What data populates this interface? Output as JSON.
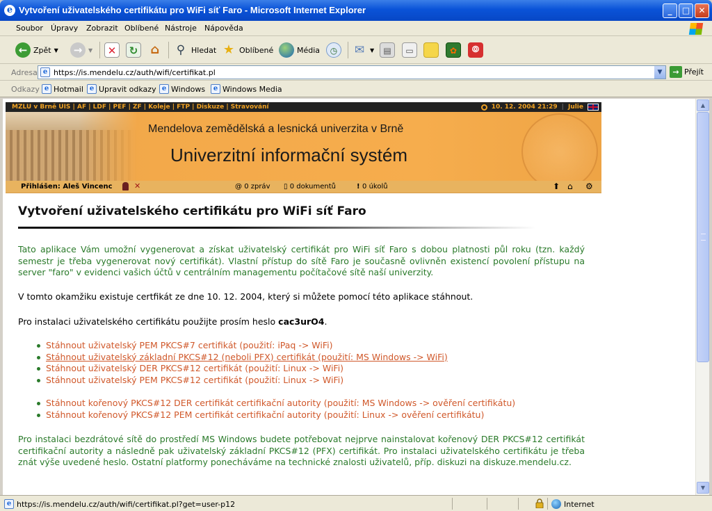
{
  "window": {
    "title": "Vytvoření uživatelského certifikátu pro WiFi síť Faro - Microsoft Internet Explorer",
    "minimize": "_",
    "maximize": "□",
    "close": "✕"
  },
  "menu": [
    "Soubor",
    "Úpravy",
    "Zobrazit",
    "Oblíbené",
    "Nástroje",
    "Nápověda"
  ],
  "toolbar": {
    "back_label": "Zpět",
    "search_label": "Hledat",
    "favorites_label": "Oblíbené",
    "media_label": "Média"
  },
  "address": {
    "label": "Adresa",
    "url": "https://is.mendelu.cz/auth/wifi/certifikat.pl",
    "go_label": "Přejít"
  },
  "links_bar": {
    "label": "Odkazy",
    "items": [
      "Hotmail",
      "Upravit odkazy",
      "Windows",
      "Windows Media"
    ]
  },
  "page": {
    "topnav": "MZLU v Brně   UIS | AF | LDF | PEF | ZF | Koleje | FTP | Diskuze | Stravování",
    "datetime": "10. 12. 2004 21:29",
    "nameday": "Julie",
    "university": "Mendelova zemědělská a lesnická univerzita v Brně",
    "system": "Univerzitní informační systém",
    "logged_in": "Přihlášen: Aleš Vincenc",
    "messages": "0 zpráv",
    "documents": "0 dokumentů",
    "tasks": "0 úkolů",
    "heading": "Vytvoření uživatelského certifikátu pro WiFi síť Faro",
    "intro": "Tato aplikace Vám umožní vygenerovat a získat uživatelský certifikát pro WiFi síť Faro s dobou platnosti půl roku (tzn. každý semestr je třeba vygenerovat nový certifikát). Vlastní přístup do sítě Faro je současně ovlivněn existencí povolení přístupu na server \"faro\" v evidenci vašich účtů v centrálním managementu počítačové sítě naší univerzity.",
    "existing": "V tomto okamžiku existuje certfikát ze dne 10. 12. 2004, který si můžete pomocí této aplikace stáhnout.",
    "password_prefix": "Pro instalaci uživatelského certifikátu použijte prosím heslo ",
    "password": "cac3urO4",
    "password_suffix": ".",
    "user_links": [
      "Stáhnout uživatelský PEM PKCS#7 certifikát (použití: iPaq -> WiFi)",
      "Stáhnout uživatelský základní PKCS#12 (neboli PFX) certifikát (použití: MS Windows -> WiFi)",
      "Stáhnout uživatelský DER PKCS#12 certifikát (použití: Linux -> WiFi)",
      "Stáhnout uživatelský PEM PKCS#12 certifikát (použití: Linux -> WiFi)"
    ],
    "root_links": [
      "Stáhnout kořenový PKCS#12 DER certifikát certifikační autority (použití: MS Windows -> ověření certifikátu)",
      "Stáhnout kořenový PKCS#12 PEM certifikát certifikační autority (použití: Linux -> ověření certifikátu)"
    ],
    "install_note": "Pro instalaci bezdrátové sítě do prostředí MS Windows budete potřebovat nejprve nainstalovat kořenový DER PKCS#12 certifikát certifikační autority a následně pak uživatelský základní PKCS#12 (PFX) certifikát. Pro instalaci uživatelského certifikátu je třeba znát výše uvedené heslo. Ostatní platformy ponecháváme na technické znalosti uživatelů, příp. diskuzi na diskuze.mendelu.cz."
  },
  "status": {
    "url": "https://is.mendelu.cz/auth/wifi/certifikat.pl?get=user-p12",
    "zone": "Internet"
  },
  "colors": {
    "link": "#d0582a",
    "green_text": "#2a7a2a",
    "banner": "#f3a94a",
    "title_bar": "#0a53d8"
  }
}
